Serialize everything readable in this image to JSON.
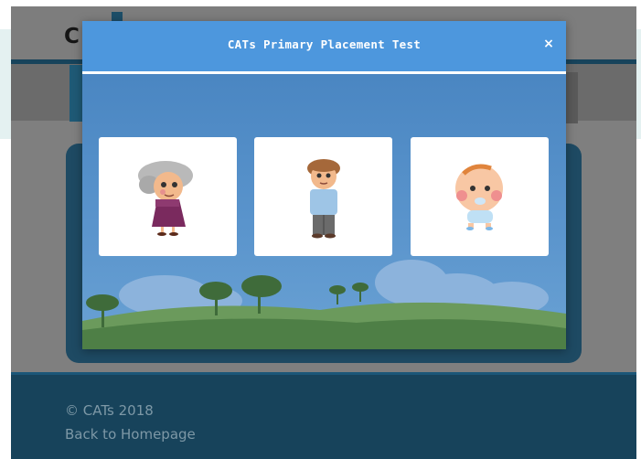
{
  "background": {
    "brand_text": "C",
    "footer": {
      "copyright": "© CATs 2018",
      "back_link": "Back to Homepage"
    }
  },
  "modal": {
    "title": "CATs Primary Placement Test",
    "close_label": "×",
    "options": [
      {
        "icon": "grandmother-icon",
        "description": "elderly woman"
      },
      {
        "icon": "man-icon",
        "description": "adult man"
      },
      {
        "icon": "baby-icon",
        "description": "baby"
      }
    ]
  },
  "colors": {
    "modal_header": "#4d97dd",
    "modal_body": "#4f86c0",
    "footer": "#17435b",
    "overlay": "#7f7f7f"
  }
}
